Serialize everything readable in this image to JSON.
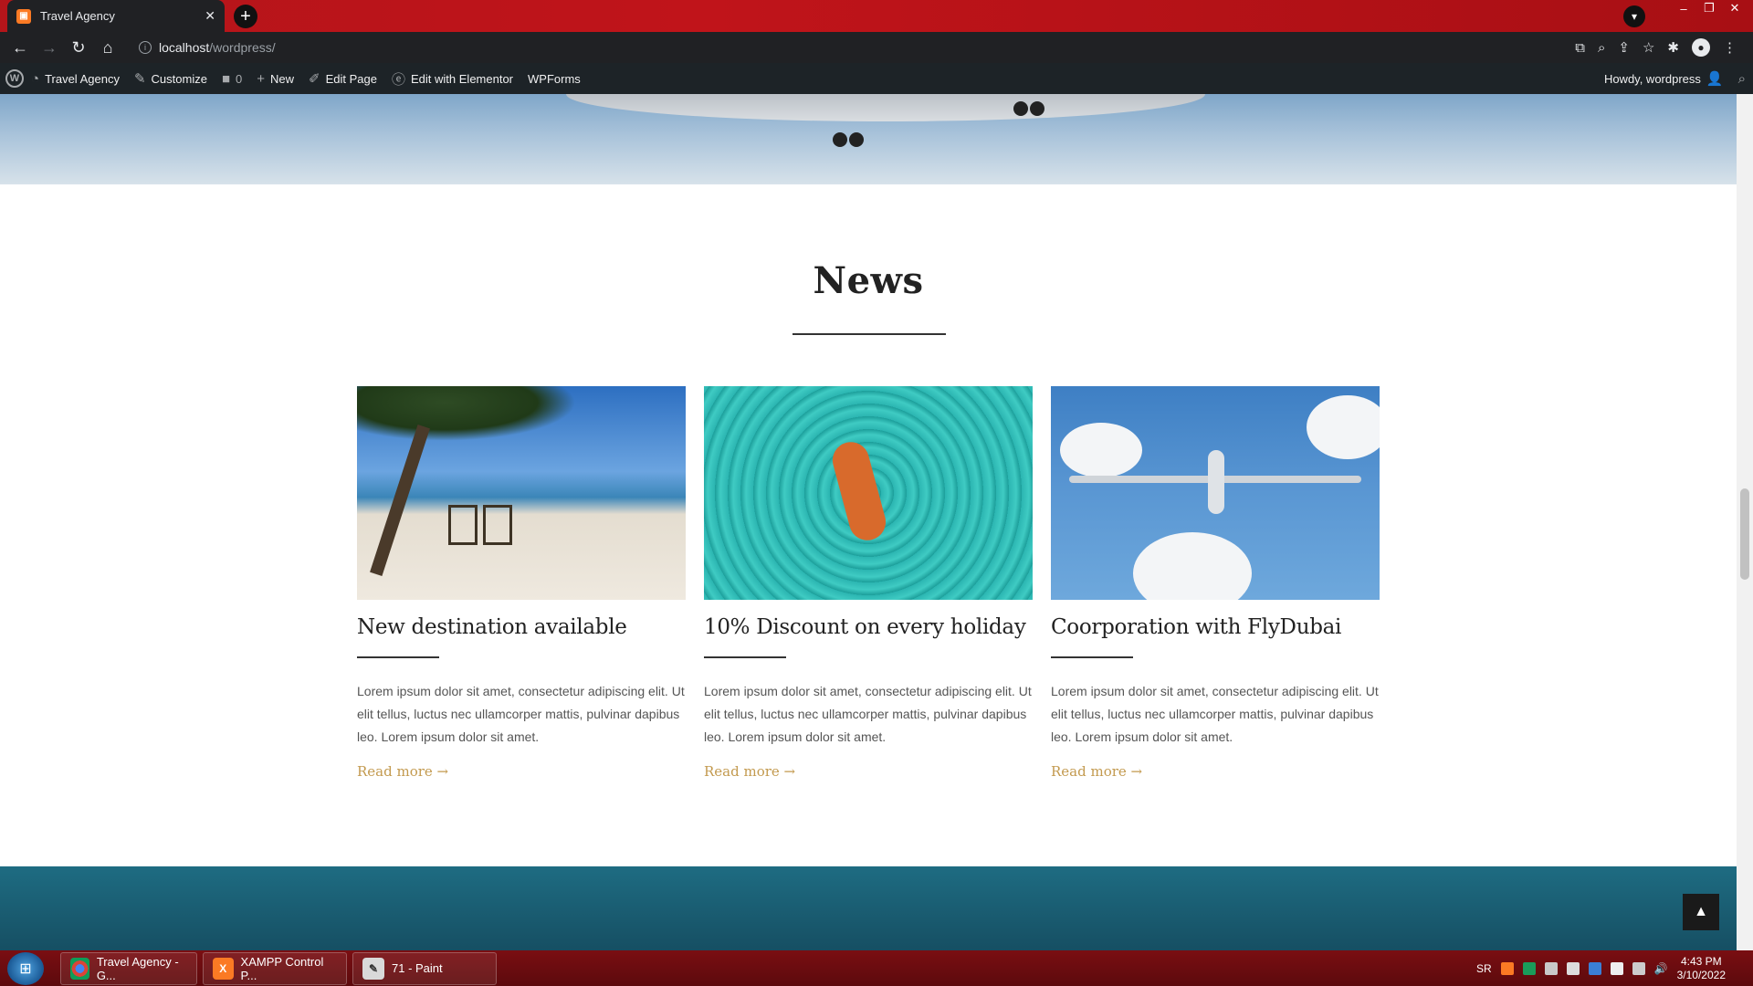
{
  "browser": {
    "tab_title": "Travel Agency",
    "tab_close": "✕",
    "new_tab": "+",
    "url_host": "localhost",
    "url_path": "/wordpress/"
  },
  "wp_admin_bar": {
    "site_name": "Travel Agency",
    "customize": "Customize",
    "comments_count": "0",
    "new": "New",
    "edit_page": "Edit Page",
    "edit_elementor": "Edit with Elementor",
    "wpforms": "WPForms",
    "howdy": "Howdy, wordpress"
  },
  "news": {
    "title": "News",
    "cards": [
      {
        "title": "New destination available",
        "text": "Lorem ipsum dolor sit amet, consectetur adipiscing elit. Ut elit tellus, luctus nec ullamcorper mattis, pulvinar dapibus leo. Lorem ipsum dolor sit amet.",
        "more": "Read more →"
      },
      {
        "title": "10% Discount on every holiday",
        "text": "Lorem ipsum dolor sit amet, consectetur adipiscing elit. Ut elit tellus, luctus nec ullamcorper mattis, pulvinar dapibus leo. Lorem ipsum dolor sit amet.",
        "more": "Read more →"
      },
      {
        "title": "Coorporation with FlyDubai",
        "text": "Lorem ipsum dolor sit amet, consectetur adipiscing elit. Ut elit tellus, luctus nec ullamcorper mattis, pulvinar dapibus leo. Lorem ipsum dolor sit amet.",
        "more": "Read more →"
      }
    ]
  },
  "taskbar": {
    "items": [
      {
        "label": "Travel Agency - G..."
      },
      {
        "label": "XAMPP Control P..."
      },
      {
        "label": "71 - Paint"
      }
    ],
    "lang": "SR",
    "time": "4:43 PM",
    "date": "3/10/2022"
  },
  "colors": {
    "accent_link": "#c39a4f",
    "wp_bar": "#1d2327",
    "chrome_frame": "#b4151a"
  }
}
